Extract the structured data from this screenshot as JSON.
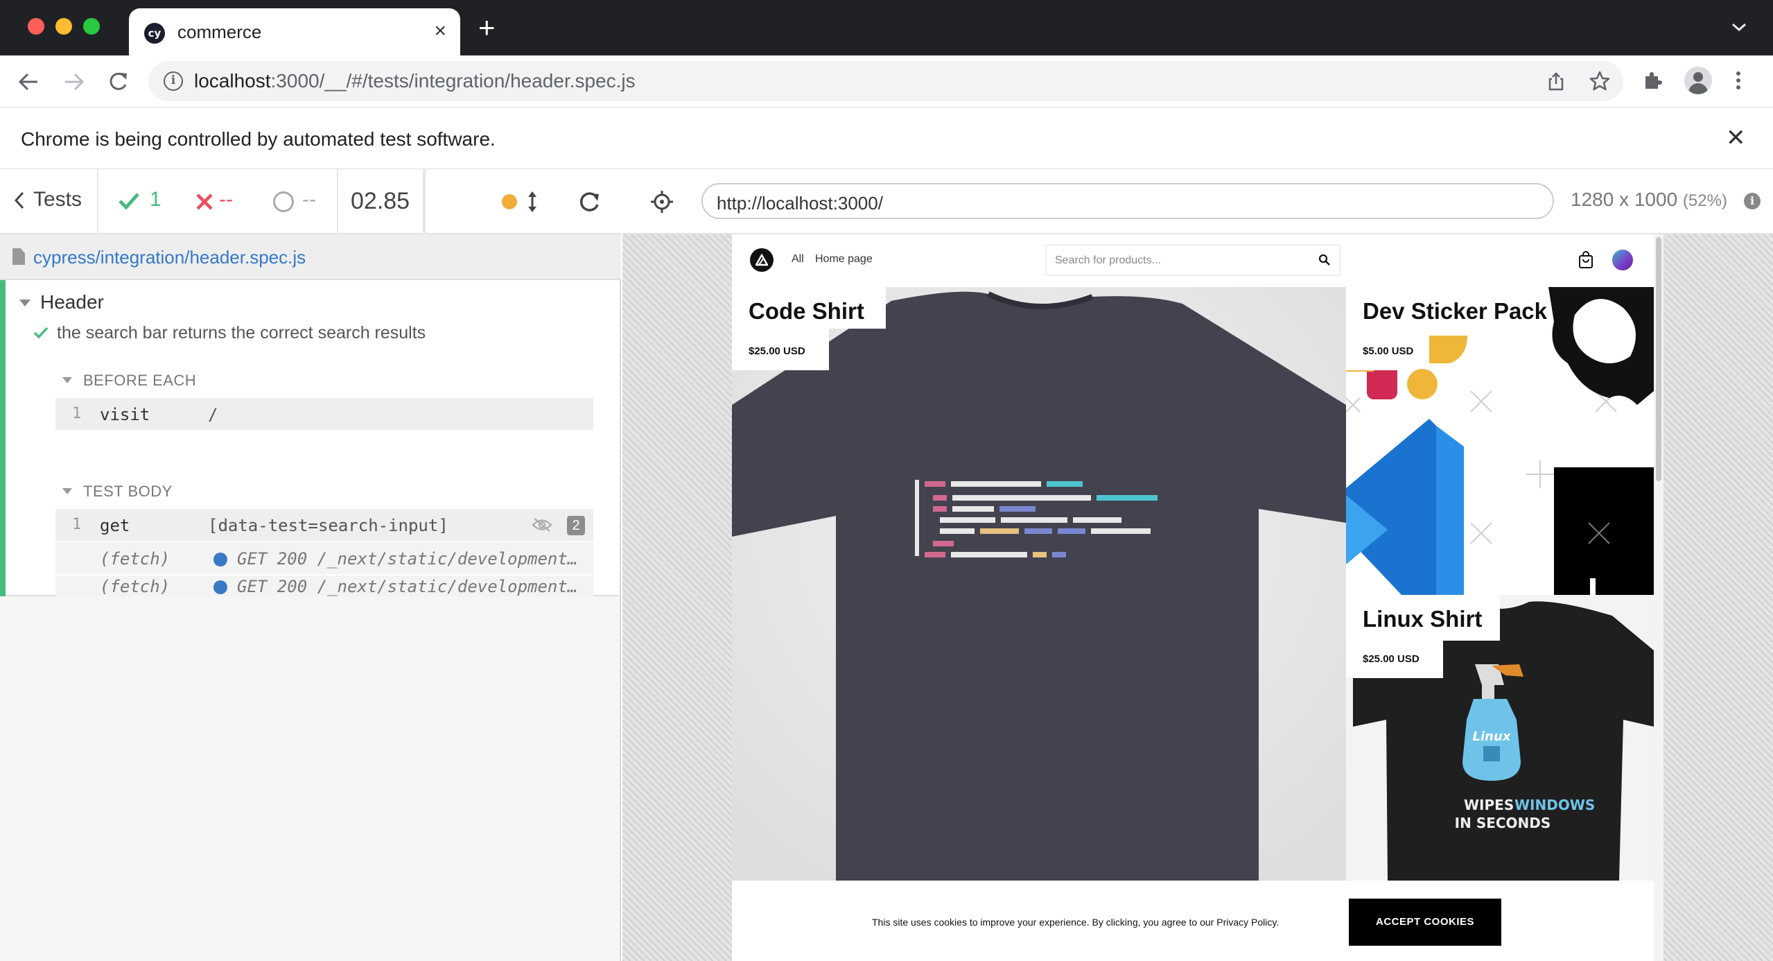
{
  "browser": {
    "tab_title": "commerce",
    "tab_favicon_text": "cy",
    "url_host": "localhost",
    "url_rest": ":3000/__/#/tests/integration/header.spec.js",
    "infobar_text": "Chrome is being controlled by automated test software."
  },
  "reporter": {
    "tests_label": "Tests",
    "passed_count": "1",
    "failed_count": "--",
    "pending_count": "--",
    "duration": "02.85",
    "spec_path": "cypress/integration/header.spec.js",
    "suite_title": "Header",
    "test_title": "the search bar returns the correct search results",
    "before_each_label": "BEFORE EACH",
    "test_body_label": "TEST BODY",
    "before_each_commands": [
      {
        "num": "1",
        "name": "visit",
        "message": "/"
      }
    ],
    "test_body_commands": [
      {
        "num": "1",
        "name": "get",
        "message": "[data-test=search-input]",
        "badge": "2"
      },
      {
        "num": "",
        "name": "(fetch)",
        "message": "GET 200 /_next/static/development…"
      },
      {
        "num": "",
        "name": "(fetch)",
        "message": "GET 200 /_next/static/development…"
      }
    ]
  },
  "aut": {
    "url": "http://localhost:3000/",
    "viewport": "1280 x 1000",
    "viewport_scale": "(52%)"
  },
  "app": {
    "nav_links": [
      "All",
      "Home page"
    ],
    "search_placeholder": "Search for products...",
    "products": [
      {
        "title": "Code Shirt",
        "price": "$25.00 USD"
      },
      {
        "title": "Dev Sticker Pack",
        "price": "$5.00 USD"
      },
      {
        "title": "Linux Shirt",
        "price": "$25.00 USD"
      }
    ],
    "linux_shirt_print": [
      "Linux",
      "WIPES",
      "WINDOWS",
      "IN SECONDS"
    ],
    "cookie_text": "This site uses cookies to improve your experience. By clicking, you agree to our Privacy Policy.",
    "cookie_button": "ACCEPT COOKIES"
  },
  "colors": {
    "pass": "#47bb7e",
    "fail": "#e94f5f",
    "running": "#f0ad3a",
    "link": "#3379c9",
    "chrome_dark": "#202124"
  }
}
